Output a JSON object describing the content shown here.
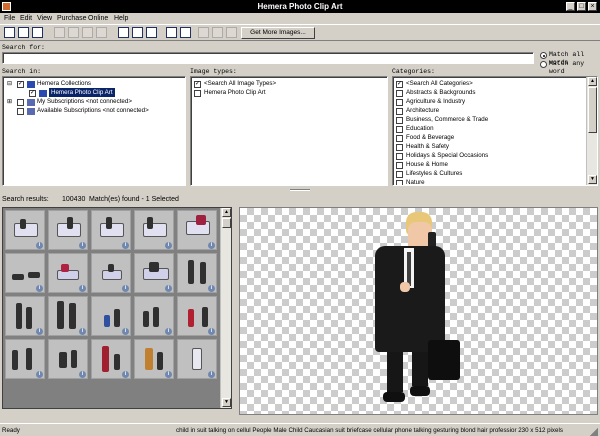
{
  "window": {
    "title": "Hemera Photo Clip Art"
  },
  "menu": [
    "File",
    "Edit",
    "View",
    "Purchase",
    "Online",
    "Help"
  ],
  "toolbar": {
    "icons": [
      "save-icon",
      "open-icon",
      "export-icon",
      "cut-icon",
      "copy-icon",
      "paste-icon",
      "back-icon",
      "print-icon",
      "print-preview-icon",
      "zoom-icon",
      "search-icon",
      "help-icon",
      "play-icon",
      "forward-icon"
    ],
    "get_more_label": "Get More Images..."
  },
  "search": {
    "label": "Search for:",
    "value": "",
    "match_all": "Match all words",
    "match_any": "Match any word",
    "selected": "all"
  },
  "search_in": {
    "label": "Search in:",
    "items": [
      {
        "label": "Hemera Collections",
        "checked": true,
        "expander": "-"
      },
      {
        "label": "Hemera Photo Clip Art",
        "checked": true,
        "selected": true
      },
      {
        "label": "My Subscriptions <not connected>",
        "checked": false,
        "expander": "+"
      },
      {
        "label": "Available Subscriptions <not connected>",
        "checked": false
      }
    ]
  },
  "image_types": {
    "label": "Image types:",
    "items": [
      {
        "label": "<Search All Image Types>",
        "checked": true
      },
      {
        "label": "Hemera Photo Clip Art",
        "checked": false
      }
    ]
  },
  "categories": {
    "label": "Categories:",
    "items": [
      {
        "label": "<Search All Categories>",
        "checked": true
      },
      {
        "label": "Abstracts & Backgrounds",
        "checked": false
      },
      {
        "label": "Agriculture & Industry",
        "checked": false
      },
      {
        "label": "Architecture",
        "checked": false
      },
      {
        "label": "Business, Commerce & Trade",
        "checked": false
      },
      {
        "label": "Education",
        "checked": false
      },
      {
        "label": "Food & Beverage",
        "checked": false
      },
      {
        "label": "Health & Safety",
        "checked": false
      },
      {
        "label": "Holidays & Special Occasions",
        "checked": false
      },
      {
        "label": "House & Home",
        "checked": false
      },
      {
        "label": "Lifestyles & Cultures",
        "checked": false
      },
      {
        "label": "Nature",
        "checked": false
      }
    ]
  },
  "results": {
    "label": "Search results:",
    "count": "100430",
    "summary": "Match(es) found - 1 Selected"
  },
  "status": {
    "left": "Ready",
    "right": "child in suit talking on cellul People Male Child Caucasian suit briefcase cellular phone talking gesturing blond hair professior 230 x 512 pixels"
  },
  "colors": {
    "titlebar": "#000000",
    "chrome": "#d4d0c8",
    "selection": "#0a246a"
  }
}
